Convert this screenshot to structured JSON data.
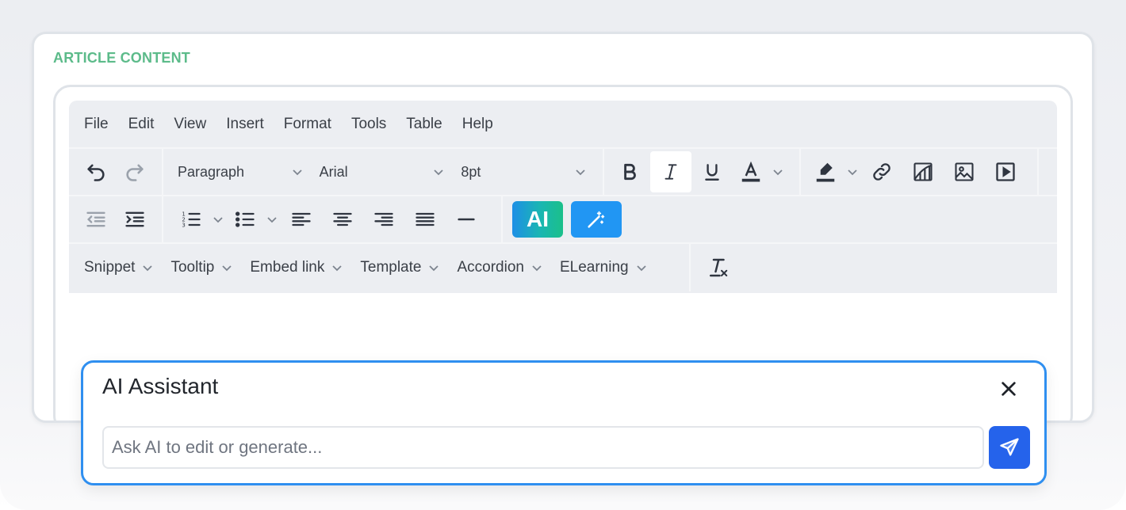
{
  "section": {
    "label": "ARTICLE CONTENT"
  },
  "menubar": {
    "items": [
      "File",
      "Edit",
      "View",
      "Insert",
      "Format",
      "Tools",
      "Table",
      "Help"
    ]
  },
  "toolbar": {
    "block_format": "Paragraph",
    "font_family": "Arial",
    "font_size": "8pt",
    "ai_label": "AI"
  },
  "plugins": {
    "items": [
      "Snippet",
      "Tooltip",
      "Embed link",
      "Template",
      "Accordion",
      "ELearning"
    ]
  },
  "ai_assistant": {
    "title": "AI Assistant",
    "placeholder": "Ask AI to edit or generate..."
  },
  "colors": {
    "accent": "#5cbb8a",
    "primary": "#2196f3",
    "send": "#2563eb",
    "panel_border": "#2f8ff0"
  }
}
